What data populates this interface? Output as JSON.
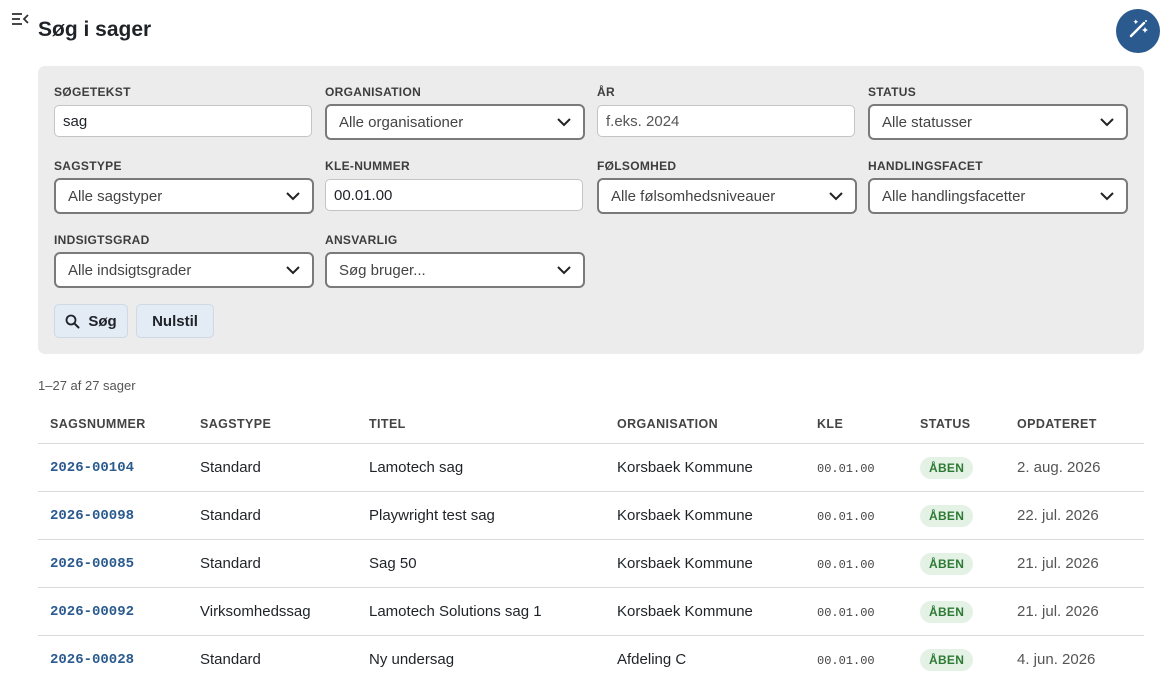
{
  "page": {
    "title": "Søg i sager"
  },
  "filters": {
    "search": {
      "label": "SØGETEKST",
      "value": "sag"
    },
    "organisation": {
      "label": "ORGANISATION",
      "value": "Alle organisationer"
    },
    "year": {
      "label": "ÅR",
      "placeholder": "f.eks. 2024"
    },
    "status": {
      "label": "STATUS",
      "value": "Alle statusser"
    },
    "sagstype": {
      "label": "SAGSTYPE",
      "value": "Alle sagstyper"
    },
    "kle": {
      "label": "KLE-NUMMER",
      "value": "00.01.00"
    },
    "folsomhed": {
      "label": "FØLSOMHED",
      "value": "Alle følsomhedsniveauer"
    },
    "handlingsfacet": {
      "label": "HANDLINGSFACET",
      "value": "Alle handlingsfacetter"
    },
    "indsigtsgrad": {
      "label": "INDSIGTSGRAD",
      "value": "Alle indsigtsgrader"
    },
    "ansvarlig": {
      "label": "ANSVARLIG",
      "value": "Søg bruger..."
    },
    "search_button": "Søg",
    "reset_button": "Nulstil"
  },
  "results": {
    "count_text": "1–27 af 27 sager",
    "columns": [
      "SAGSNUMMER",
      "SAGSTYPE",
      "TITEL",
      "ORGANISATION",
      "KLE",
      "STATUS",
      "OPDATERET"
    ],
    "rows": [
      {
        "number": "2026-00104",
        "type": "Standard",
        "title": "Lamotech sag",
        "org": "Korsbaek Kommune",
        "kle": "00.01.00",
        "status": "ÅBEN",
        "updated": "2. aug. 2026"
      },
      {
        "number": "2026-00098",
        "type": "Standard",
        "title": "Playwright test sag",
        "org": "Korsbaek Kommune",
        "kle": "00.01.00",
        "status": "ÅBEN",
        "updated": "22. jul. 2026"
      },
      {
        "number": "2026-00085",
        "type": "Standard",
        "title": "Sag 50",
        "org": "Korsbaek Kommune",
        "kle": "00.01.00",
        "status": "ÅBEN",
        "updated": "21. jul. 2026"
      },
      {
        "number": "2026-00092",
        "type": "Virksomhedssag",
        "title": "Lamotech Solutions sag 1",
        "org": "Korsbaek Kommune",
        "kle": "00.01.00",
        "status": "ÅBEN",
        "updated": "21. jul. 2026"
      },
      {
        "number": "2026-00028",
        "type": "Standard",
        "title": "Ny undersag",
        "org": "Afdeling C",
        "kle": "00.01.00",
        "status": "ÅBEN",
        "updated": "4. jun. 2026"
      }
    ]
  },
  "icons": {
    "menu": "menu-collapse-icon",
    "magic": "magic-wand-icon",
    "chevron": "chevron-down-icon",
    "search": "search-icon"
  },
  "colors": {
    "accent": "#2a5a8e",
    "status_open_bg": "#e3f2e4",
    "status_open_text": "#2e7a35"
  }
}
